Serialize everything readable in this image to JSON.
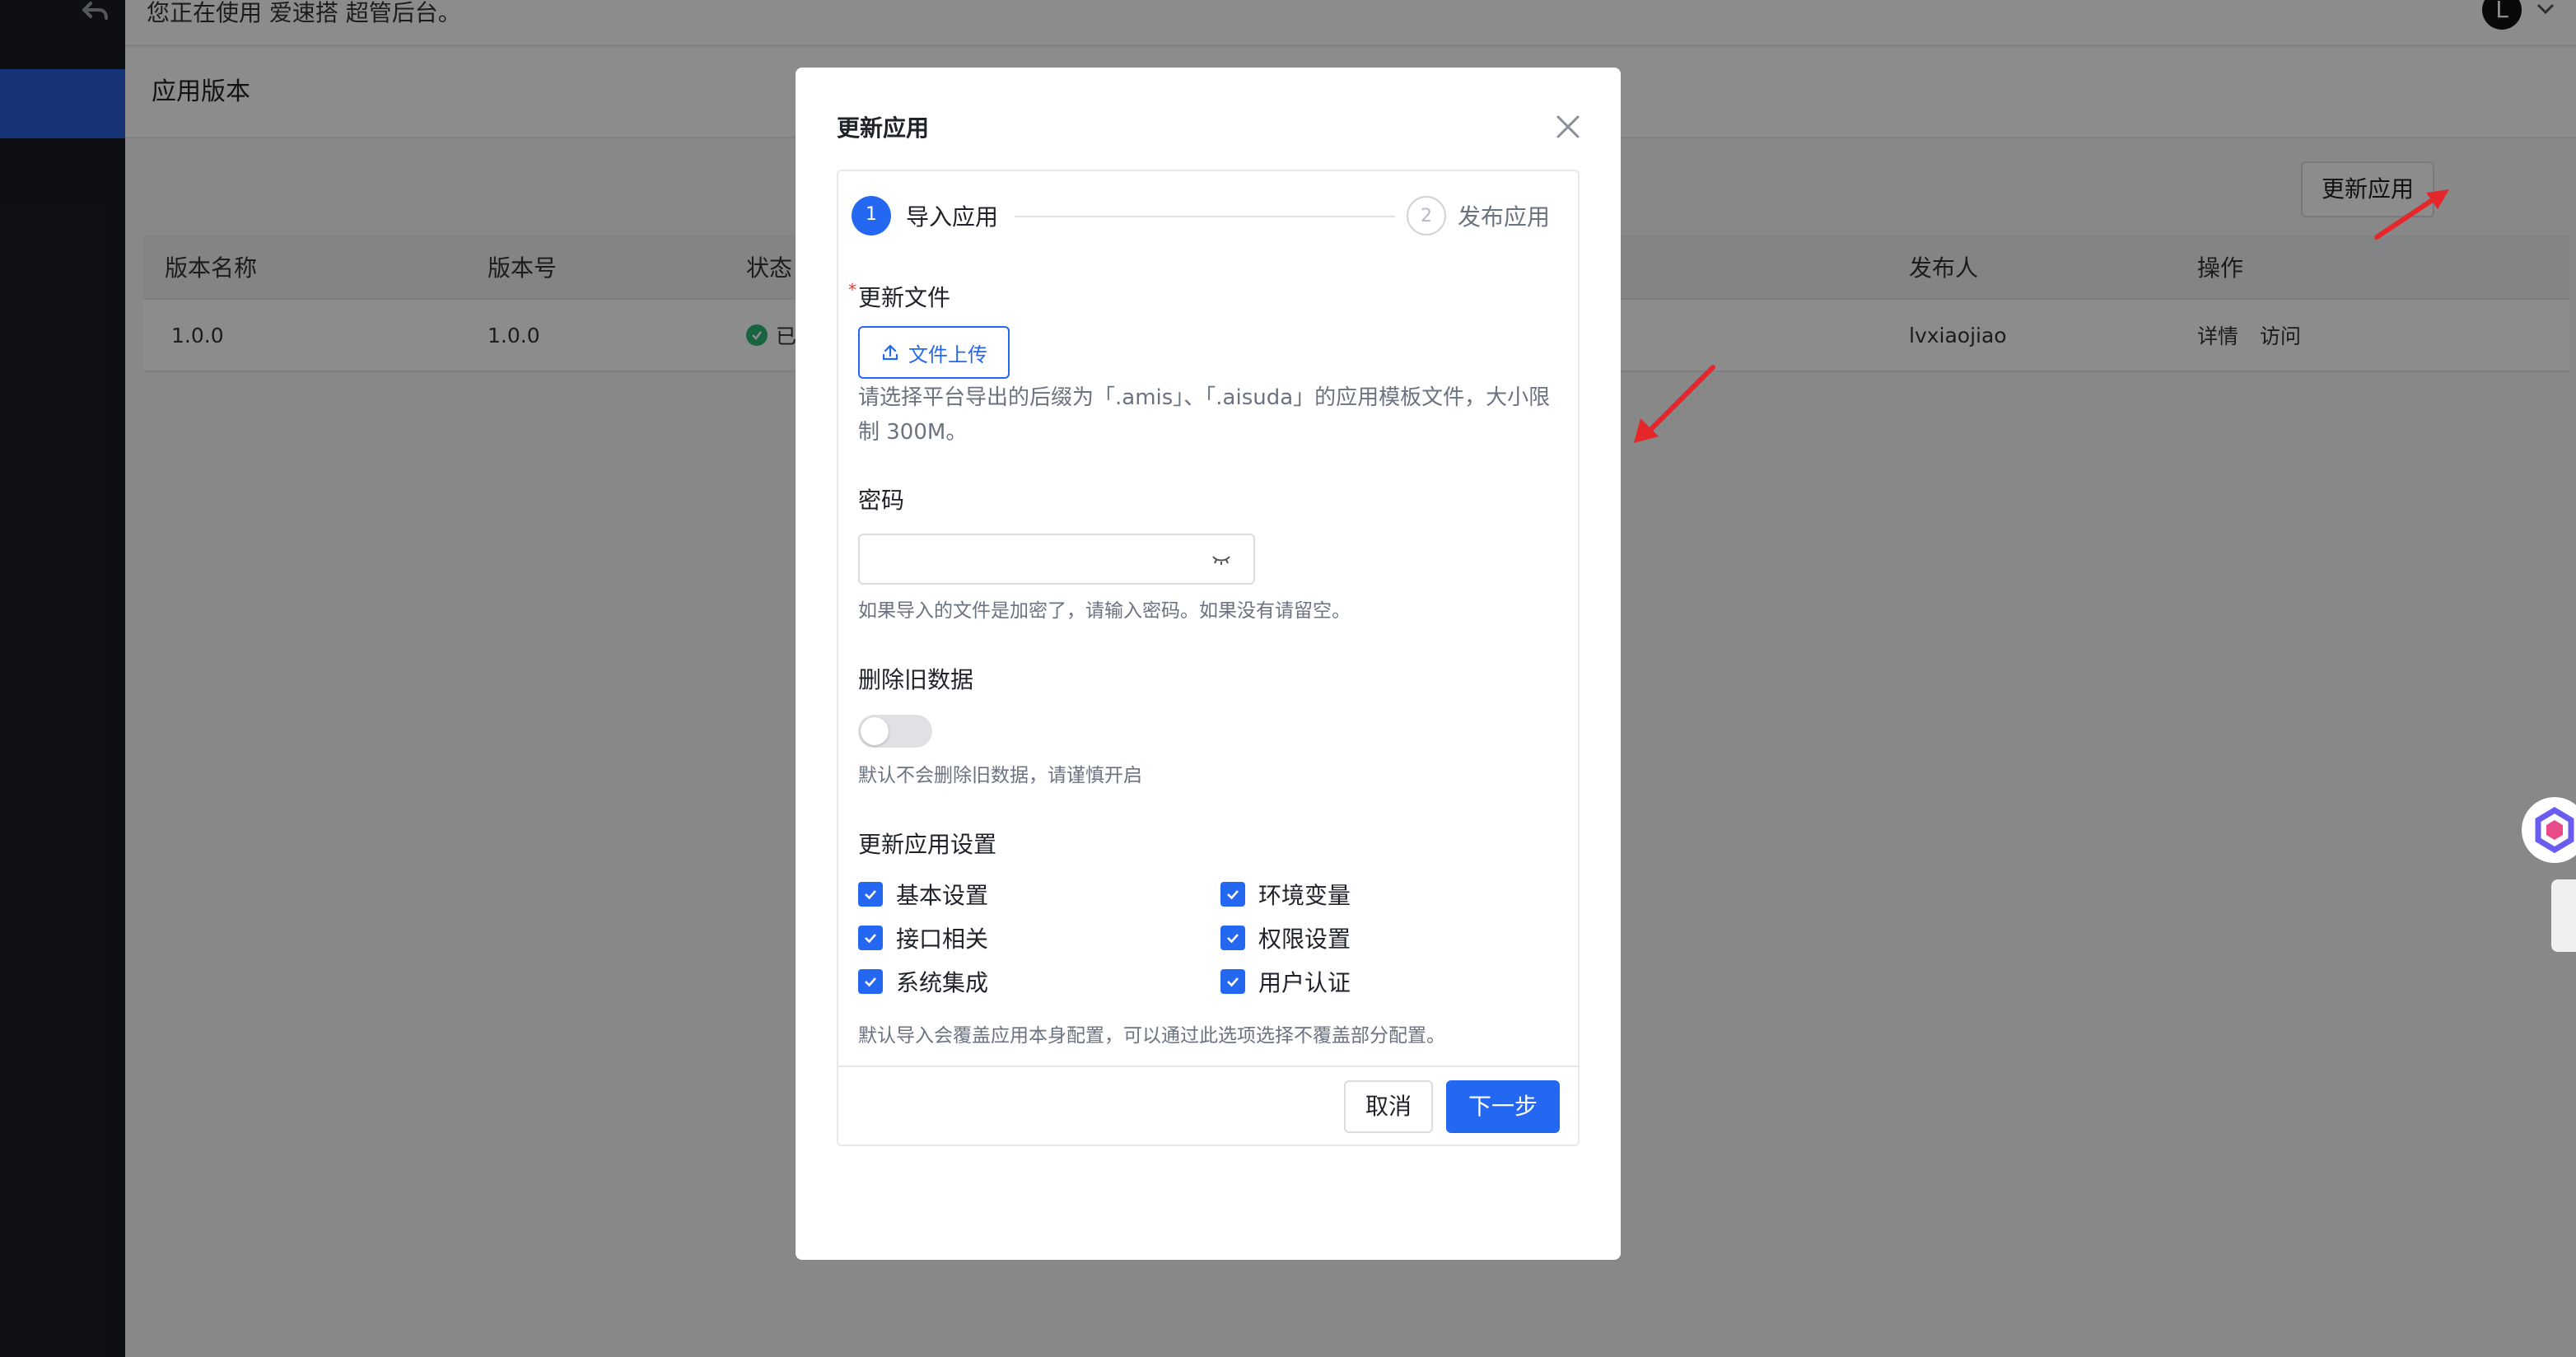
{
  "colors": {
    "primary": "#2468f2",
    "arrow": "#e5262a",
    "success": "#2bb673"
  },
  "topbar": {
    "notice": "您正在使用 爱速搭 超管后台。",
    "avatar_letter": "L"
  },
  "page": {
    "title": "应用版本",
    "update_button": "更新应用"
  },
  "table": {
    "headers": {
      "version_name": "版本名称",
      "version_no": "版本号",
      "status": "状态",
      "publisher": "发布人",
      "actions": "操作"
    },
    "rows": [
      {
        "version_name": "1.0.0",
        "version_no": "1.0.0",
        "status": "已",
        "publisher": "lvxiaojiao",
        "detail": "详情",
        "visit": "访问"
      }
    ]
  },
  "dialog": {
    "title": "更新应用",
    "steps": [
      {
        "number": "1",
        "label": "导入应用"
      },
      {
        "number": "2",
        "label": "发布应用"
      }
    ],
    "file": {
      "label": "更新文件",
      "required_mark": "*",
      "upload_button": "文件上传",
      "hint": "请选择平台导出的后缀为「.amis」、「.aisuda」的应用模板文件，大小限制 300M。"
    },
    "password": {
      "label": "密码",
      "value": "",
      "hint": "如果导入的文件是加密了，请输入密码。如果没有请留空。"
    },
    "delete_old": {
      "label": "删除旧数据",
      "enabled": false,
      "hint": "默认不会删除旧数据，请谨慎开启"
    },
    "settings": {
      "label": "更新应用设置",
      "options": [
        {
          "label": "基本设置",
          "checked": true
        },
        {
          "label": "环境变量",
          "checked": true
        },
        {
          "label": "接口相关",
          "checked": true
        },
        {
          "label": "权限设置",
          "checked": true
        },
        {
          "label": "系统集成",
          "checked": true
        },
        {
          "label": "用户认证",
          "checked": true
        }
      ],
      "hint": "默认导入会覆盖应用本身配置，可以通过此选项选择不覆盖部分配置。"
    },
    "cancel": "取消",
    "next": "下一步"
  }
}
